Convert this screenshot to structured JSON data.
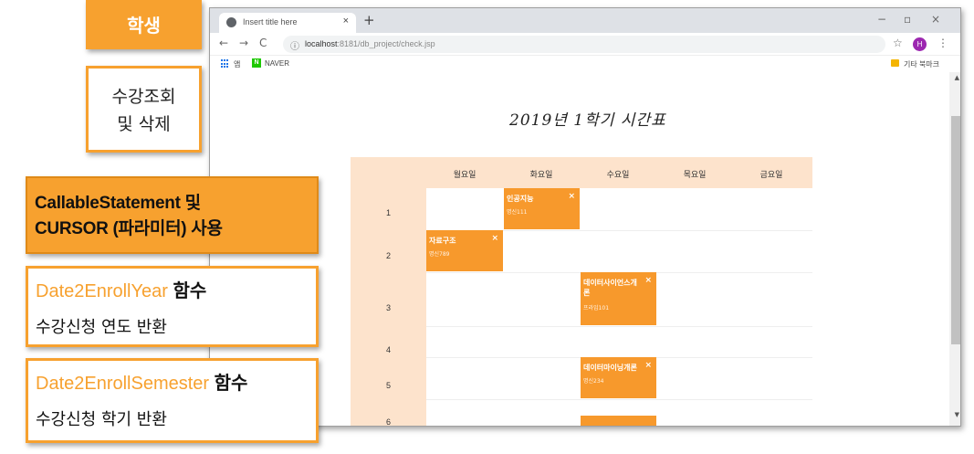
{
  "annotations": {
    "student": "학생",
    "view_delete": [
      "수강조회",
      "및 삭제"
    ],
    "callable": [
      "CallableStatement 및",
      "CURSOR (파라미터) 사용"
    ],
    "year_fn": {
      "name": "Date2EnrollYear",
      "kw": "함수",
      "desc": "수강신청 연도 반환"
    },
    "semester_fn": {
      "name": "Date2EnrollSemester",
      "kw": "함수",
      "desc": "수강신청 학기 반환"
    }
  },
  "browser": {
    "tab_title": "Insert title here",
    "tab_close": "×",
    "new_tab": "+",
    "window_controls": {
      "minimize": "−",
      "restore": "▫",
      "close": "×"
    },
    "nav": {
      "back": "←",
      "forward": "→",
      "reload": "C"
    },
    "url_host": "localhost",
    "url_path": ":8181/db_project/check.jsp",
    "info_icon": "ⓘ",
    "star": "☆",
    "profile": "H",
    "menu": "⋮",
    "bookmarks": {
      "apps": "앱",
      "naver_badge": "N",
      "naver": "NAVER",
      "other": "기타 북마크"
    },
    "scroll_up": "▲",
    "scroll_down": "▼"
  },
  "page": {
    "heading": "2019년 1학기 시간표",
    "timetable": {
      "days": [
        "월요일",
        "화요일",
        "수요일",
        "목요일",
        "금요일"
      ],
      "periods": [
        "1",
        "2",
        "3",
        "4",
        "5",
        "6"
      ],
      "courses": [
        {
          "name": "인공지능",
          "room": "명신111",
          "delete": "×",
          "day": 1,
          "period": 1
        },
        {
          "name": "자료구조",
          "room": "명신789",
          "delete": "×",
          "day": 0,
          "period": 2
        },
        {
          "name": "데이터사이언스개론",
          "name_lines": [
            "데이터사이언스개",
            "론"
          ],
          "room": "프라임101",
          "delete": "×",
          "day": 2,
          "period": 3
        },
        {
          "name": "데이터마이닝개론",
          "room": "명신234",
          "delete": "×",
          "day": 2,
          "period": 5
        }
      ]
    }
  },
  "colors": {
    "accent": "#f7a12f",
    "course_block": "#f7992c",
    "table_header": "#fde3cc"
  }
}
